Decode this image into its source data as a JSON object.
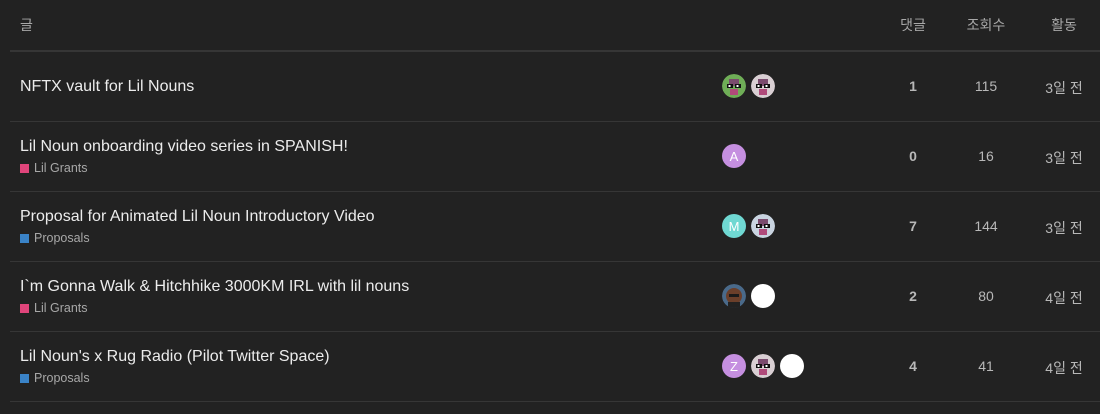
{
  "headers": {
    "topic": "글",
    "replies": "댓글",
    "views": "조회수",
    "activity": "활동"
  },
  "topics": [
    {
      "title": "NFTX vault for Lil Nouns",
      "category": null,
      "category_color": null,
      "avatars": [
        {
          "type": "noun",
          "bg": "#6fae57",
          "letter": ""
        },
        {
          "type": "noun",
          "bg": "#d9cfd3",
          "letter": ""
        }
      ],
      "replies": "1",
      "views": "115",
      "activity": "3일 전"
    },
    {
      "title": "Lil Noun onboarding video series in SPANISH!",
      "category": "Lil Grants",
      "category_color": "#e0457b",
      "avatars": [
        {
          "type": "letter",
          "bg": "#c58fe0",
          "letter": "A"
        }
      ],
      "replies": "0",
      "views": "16",
      "activity": "3일 전"
    },
    {
      "title": "Proposal for Animated Lil Noun Introductory Video",
      "category": "Proposals",
      "category_color": "#3a83c7",
      "avatars": [
        {
          "type": "letter",
          "bg": "#6fd8d2",
          "letter": "M"
        },
        {
          "type": "noun",
          "bg": "#c9d4e0",
          "letter": ""
        }
      ],
      "replies": "7",
      "views": "144",
      "activity": "3일 전"
    },
    {
      "title": "I`m Gonna Walk & Hitchhike 3000KM IRL with lil nouns",
      "category": "Lil Grants",
      "category_color": "#e0457b",
      "avatars": [
        {
          "type": "photo",
          "bg": "#4a6a8a",
          "letter": ""
        },
        {
          "type": "blank",
          "bg": "#ffffff",
          "letter": ""
        }
      ],
      "replies": "2",
      "views": "80",
      "activity": "4일 전"
    },
    {
      "title": "Lil Noun's x Rug Radio (Pilot Twitter Space)",
      "category": "Proposals",
      "category_color": "#3a83c7",
      "avatars": [
        {
          "type": "letter",
          "bg": "#c58fe0",
          "letter": "Z"
        },
        {
          "type": "noun",
          "bg": "#d9cfd3",
          "letter": ""
        },
        {
          "type": "blank",
          "bg": "#ffffff",
          "letter": ""
        }
      ],
      "replies": "4",
      "views": "41",
      "activity": "4일 전"
    }
  ]
}
